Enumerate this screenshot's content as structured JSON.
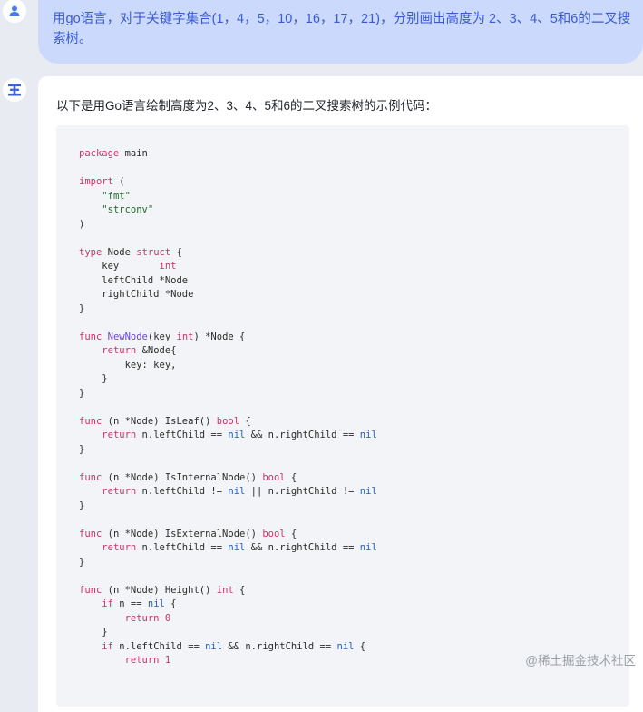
{
  "user_message": {
    "line1": "用go语言，对于关键字集合(1，4，5，10，16，17，21)，分别画出高度为 2、3、4、5和6的二叉搜",
    "line2": "索树。"
  },
  "assistant": {
    "intro": "以下是用Go语言绘制高度为2、3、4、5和6的二叉搜索树的示例代码："
  },
  "code": {
    "package_kw": "package",
    "package_name": " main",
    "import_kw": "import",
    "import_open": " (",
    "fmt": "\"fmt\"",
    "strconv": "\"strconv\"",
    "close_paren": ")",
    "type_kw": "type",
    "node_name": " Node ",
    "struct_kw": "struct",
    "brace_open": " {",
    "key_field": "    key       ",
    "int_kw": "int",
    "left_field": "    leftChild *Node",
    "right_field": "    rightChild *Node",
    "brace_close": "}",
    "func_kw": "func",
    "newnode_fn": "NewNode",
    "newnode_args_a": "(key ",
    "newnode_args_b": ") *Node {",
    "return_kw": "return",
    "return_node": " &Node{",
    "key_assign": "        key: key,",
    "inner_close": "    }",
    "recv": " (n *Node) ",
    "isleaf_sig": "IsLeaf() ",
    "bool_kw": "bool",
    "isinternal_sig": "IsInternalNode() ",
    "isexternal_sig": "IsExternalNode() ",
    "height_sig": "Height() ",
    "left_eq": " n.leftChild == ",
    "left_ne": " n.leftChild != ",
    "and_right_eq": " && n.rightChild == ",
    "or_right_ne": " || n.rightChild != ",
    "nil": "nil",
    "if_kw": "if",
    "n_eq": " n == ",
    "left_eq_if": " n.leftChild == ",
    "zero": "0",
    "one": "1",
    "indent4": "    ",
    "indent8": "        "
  },
  "watermark": {
    "text": "@稀土掘金技术社区"
  }
}
